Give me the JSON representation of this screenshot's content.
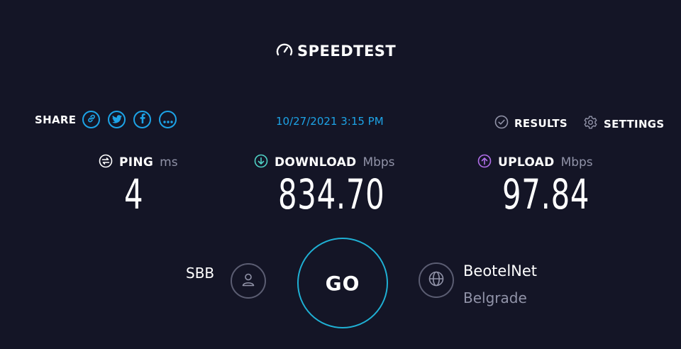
{
  "logo": {
    "text": "SPEEDTEST",
    "icon": "gauge-icon"
  },
  "share": {
    "label": "SHARE",
    "buttons": [
      {
        "icon": "link-icon"
      },
      {
        "icon": "twitter-icon"
      },
      {
        "icon": "facebook-icon"
      },
      {
        "icon": "more-icon"
      }
    ]
  },
  "timestamp": "10/27/2021 3:15 PM",
  "nav": {
    "results_label": "RESULTS",
    "settings_label": "SETTINGS"
  },
  "metrics": {
    "ping": {
      "label": "PING",
      "unit": "ms",
      "value": "4"
    },
    "download": {
      "label": "DOWNLOAD",
      "unit": "Mbps",
      "value": "834.70"
    },
    "upload": {
      "label": "UPLOAD",
      "unit": "Mbps",
      "value": "97.84"
    }
  },
  "isp": {
    "name": "SBB"
  },
  "go_label": "GO",
  "server": {
    "name": "BeotelNet",
    "location": "Belgrade"
  },
  "colors": {
    "background": "#141526",
    "accent_blue": "#1da3e6",
    "download_icon": "#4fd1c5",
    "upload_icon": "#b06ee8",
    "go_ring": "#1fb0d4",
    "muted": "#9193a8"
  }
}
